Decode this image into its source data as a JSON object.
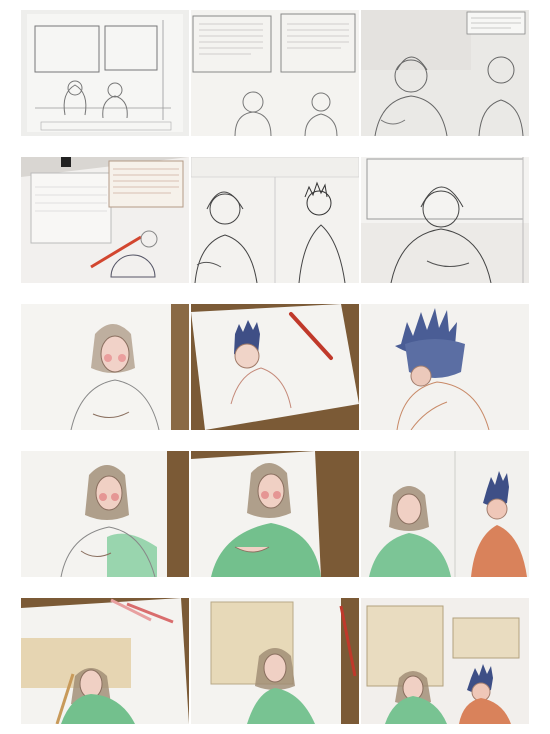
{
  "collage": {
    "rows": 5,
    "columns": 3,
    "tiles": [
      {
        "stage": "pencil-sketch-panels",
        "row": 1,
        "col": 1
      },
      {
        "stage": "pencil-sketch-text-boxes",
        "row": 1,
        "col": 2
      },
      {
        "stage": "pencil-sketch-closeup",
        "row": 1,
        "col": 3
      },
      {
        "stage": "lightbox-transfer",
        "row": 2,
        "col": 1
      },
      {
        "stage": "inked-line-art-pair",
        "row": 2,
        "col": 2
      },
      {
        "stage": "inked-line-art-closeup",
        "row": 2,
        "col": 3
      },
      {
        "stage": "color-pencil-face",
        "row": 3,
        "col": 1
      },
      {
        "stage": "color-pencil-hair-blue",
        "row": 3,
        "col": 2
      },
      {
        "stage": "color-pencil-hair-closeup",
        "row": 3,
        "col": 3
      },
      {
        "stage": "color-skin-tones",
        "row": 4,
        "col": 1
      },
      {
        "stage": "color-green-robe",
        "row": 4,
        "col": 2
      },
      {
        "stage": "color-both-figures",
        "row": 4,
        "col": 3
      },
      {
        "stage": "color-background-box",
        "row": 5,
        "col": 1
      },
      {
        "stage": "color-beige-panel",
        "row": 5,
        "col": 2
      },
      {
        "stage": "finished-panels",
        "row": 5,
        "col": 3
      }
    ],
    "colors": {
      "paper": "#f3f2ef",
      "wood": "#7a5430",
      "graphite": "#8a8a8a",
      "robe_green": "#7fc39a",
      "hair_blue": "#4a5a8c",
      "skin_pink": "#e9b7a5",
      "beige": "#e7d9b8",
      "orange_shirt": "#d9825b",
      "pencil_red": "#c0392b"
    }
  }
}
